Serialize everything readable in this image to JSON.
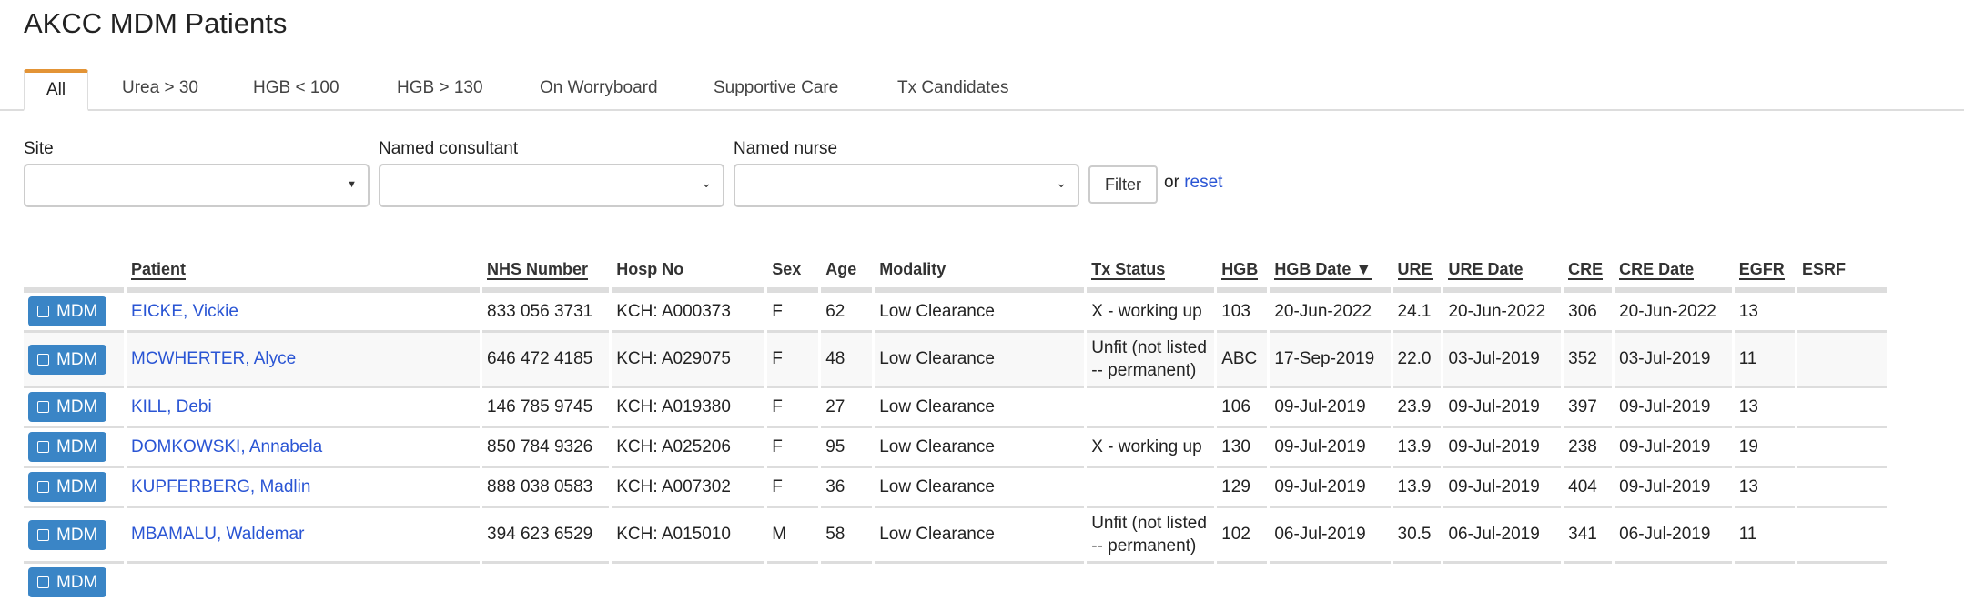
{
  "title": "AKCC MDM Patients",
  "tabs": [
    {
      "label": "All",
      "active": true
    },
    {
      "label": "Urea > 30"
    },
    {
      "label": "HGB < 100"
    },
    {
      "label": "HGB > 130"
    },
    {
      "label": "On Worryboard"
    },
    {
      "label": "Supportive Care"
    },
    {
      "label": "Tx Candidates"
    }
  ],
  "filters": {
    "site_label": "Site",
    "site_value": "",
    "consultant_label": "Named consultant",
    "consultant_value": "",
    "nurse_label": "Named nurse",
    "nurse_value": "",
    "filter_button": "Filter",
    "or_text": "or",
    "reset_link": "reset"
  },
  "table": {
    "columns": [
      "Patient",
      "NHS Number",
      "Hosp No",
      "Sex",
      "Age",
      "Modality",
      "Tx Status",
      "HGB",
      "HGB Date ▼",
      "URE",
      "URE Date",
      "CRE",
      "CRE Date",
      "EGFR",
      "ESRF"
    ],
    "mdm_label": "MDM",
    "rows": [
      {
        "patient": "EICKE, Vickie",
        "nhs": "833 056 3731",
        "hosp": "KCH: A000373",
        "sex": "F",
        "age": "62",
        "modality": "Low Clearance",
        "tx": "X - working up",
        "hgb": "103",
        "hgb_date": "20-Jun-2022",
        "ure": "24.1",
        "ure_date": "20-Jun-2022",
        "cre": "306",
        "cre_date": "20-Jun-2022",
        "egfr": "13",
        "esrf": ""
      },
      {
        "patient": "MCWHERTER, Alyce",
        "nhs": "646 472 4185",
        "hosp": "KCH: A029075",
        "sex": "F",
        "age": "48",
        "modality": "Low Clearance",
        "tx": "Unfit (not listed -- permanent)",
        "hgb": "ABC",
        "hgb_date": "17-Sep-2019",
        "ure": "22.0",
        "ure_date": "03-Jul-2019",
        "cre": "352",
        "cre_date": "03-Jul-2019",
        "egfr": "11",
        "esrf": ""
      },
      {
        "patient": "KILL, Debi",
        "nhs": "146 785 9745",
        "hosp": "KCH: A019380",
        "sex": "F",
        "age": "27",
        "modality": "Low Clearance",
        "tx": "",
        "hgb": "106",
        "hgb_date": "09-Jul-2019",
        "ure": "23.9",
        "ure_date": "09-Jul-2019",
        "cre": "397",
        "cre_date": "09-Jul-2019",
        "egfr": "13",
        "esrf": ""
      },
      {
        "patient": "DOMKOWSKI, Annabela",
        "nhs": "850 784 9326",
        "hosp": "KCH: A025206",
        "sex": "F",
        "age": "95",
        "modality": "Low Clearance",
        "tx": "X - working up",
        "hgb": "130",
        "hgb_date": "09-Jul-2019",
        "ure": "13.9",
        "ure_date": "09-Jul-2019",
        "cre": "238",
        "cre_date": "09-Jul-2019",
        "egfr": "19",
        "esrf": ""
      },
      {
        "patient": "KUPFERBERG, Madlin",
        "nhs": "888 038 0583",
        "hosp": "KCH: A007302",
        "sex": "F",
        "age": "36",
        "modality": "Low Clearance",
        "tx": "",
        "hgb": "129",
        "hgb_date": "09-Jul-2019",
        "ure": "13.9",
        "ure_date": "09-Jul-2019",
        "cre": "404",
        "cre_date": "09-Jul-2019",
        "egfr": "13",
        "esrf": ""
      },
      {
        "patient": "MBAMALU, Waldemar",
        "nhs": "394 623 6529",
        "hosp": "KCH: A015010",
        "sex": "M",
        "age": "58",
        "modality": "Low Clearance",
        "tx": "Unfit (not listed -- permanent)",
        "hgb": "102",
        "hgb_date": "06-Jul-2019",
        "ure": "30.5",
        "ure_date": "06-Jul-2019",
        "cre": "341",
        "cre_date": "06-Jul-2019",
        "egfr": "11",
        "esrf": ""
      }
    ]
  }
}
